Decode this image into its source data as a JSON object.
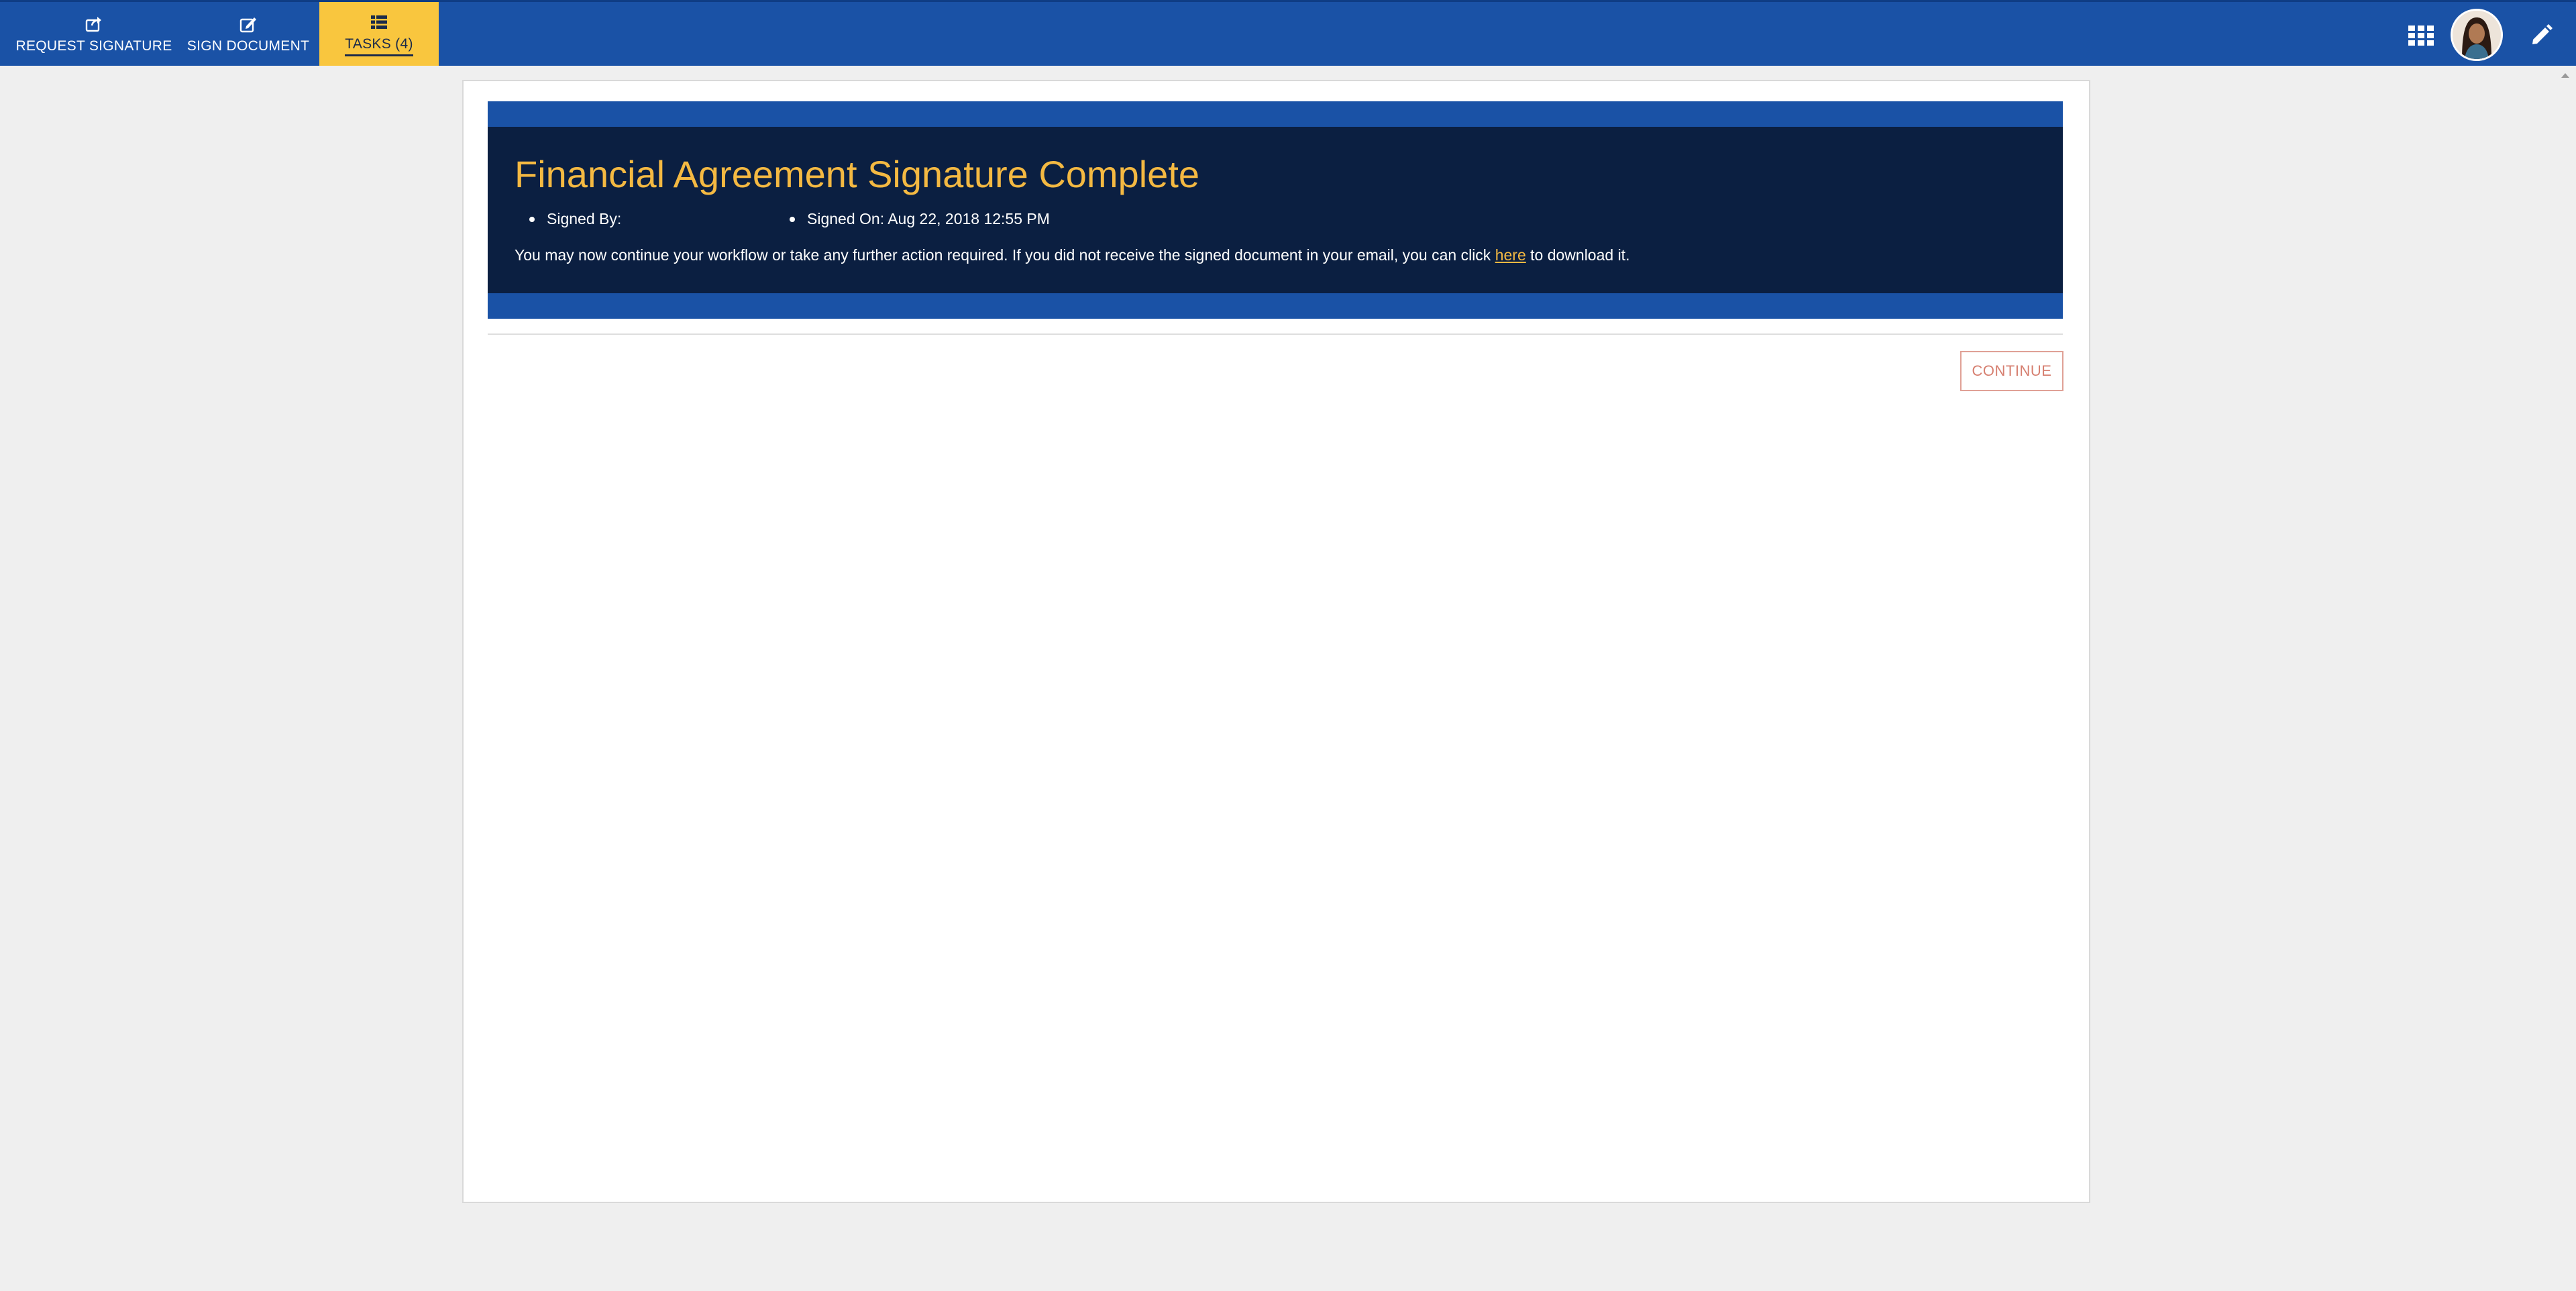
{
  "nav": {
    "request_signature": "REQUEST SIGNATURE",
    "sign_document": "SIGN DOCUMENT",
    "tasks": "TASKS (4)",
    "active_tab": "TASKS (4)"
  },
  "header_icons": [
    "share-icon",
    "edit-icon",
    "list-icon",
    "grid-icon",
    "avatar",
    "pencil-icon"
  ],
  "colors": {
    "topbar": "#1a52a6",
    "active_tab": "#f9c63e",
    "banner_bg": "#0b1f41",
    "title": "#f4b942",
    "continue_border": "#e0a196",
    "page_bg": "#efefef"
  },
  "banner": {
    "title": "Financial Agreement Signature Complete",
    "signed_by_label": "Signed By:",
    "signed_by_value": "",
    "signed_on_label": "Signed On:",
    "signed_on_value": "Aug 22, 2018 12:55 PM",
    "message_before": "You may now continue your workflow or take any further action required. If you did not receive the signed document in your email, you can click ",
    "link_text": "here",
    "message_after": " to download it."
  },
  "actions": {
    "continue_label": "CONTINUE"
  }
}
